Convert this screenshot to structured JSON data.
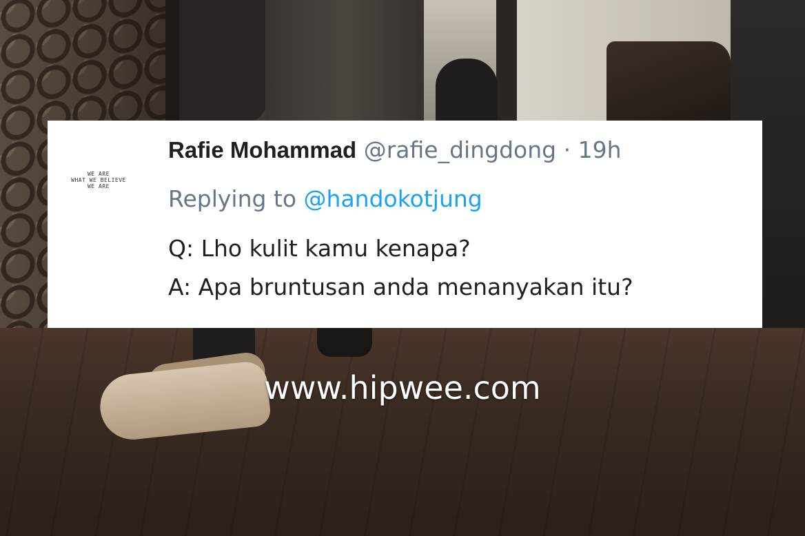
{
  "tweet": {
    "avatar_text": [
      "WE ARE",
      "WHAT WE BELIEVE",
      "WE ARE"
    ],
    "display_name": "Rafie Mohammad",
    "handle": "@rafie_dingdong",
    "separator": "·",
    "time": "19h",
    "replying_prefix": "Replying to",
    "replying_to": "@handokotjung",
    "lines": [
      "Q: Lho kulit kamu kenapa?",
      "A: Apa bruntusan anda menanyakan itu?"
    ]
  },
  "watermark": "www.hipwee.com"
}
